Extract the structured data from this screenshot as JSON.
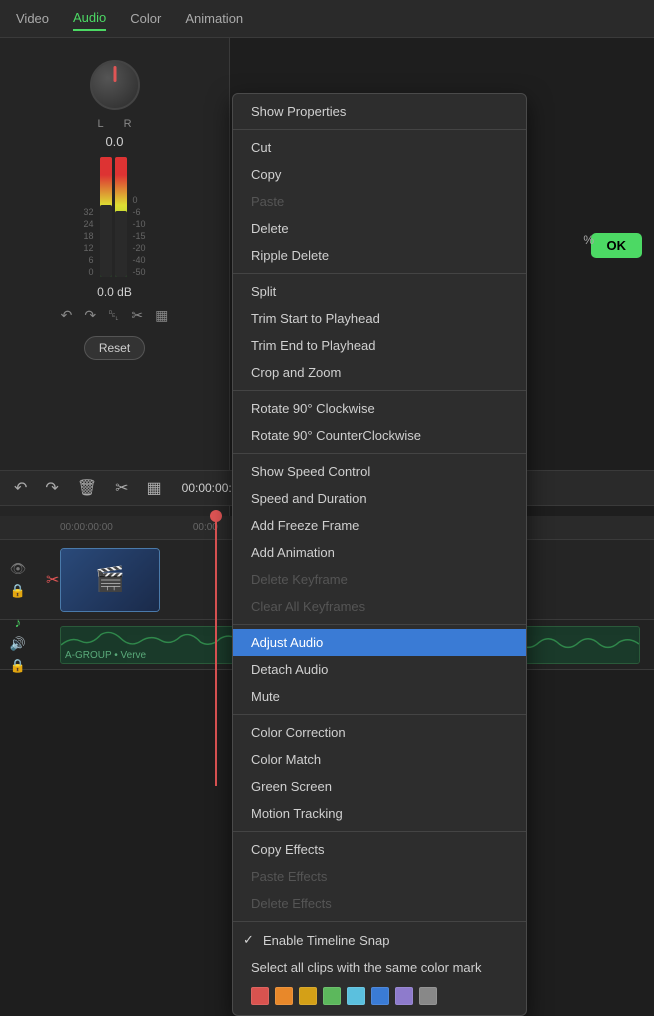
{
  "nav": {
    "items": [
      "Video",
      "Audio",
      "Color",
      "Animation"
    ],
    "active": "Audio"
  },
  "audio": {
    "volume_value": "0.0",
    "db_value": "0.0",
    "db_label": "dB",
    "reset_label": "Reset",
    "ok_label": "OK",
    "percent_label": "%"
  },
  "timeline": {
    "timecode": "00:00:00:00",
    "timecode2": "00:00",
    "track_label": "A-GROUP • Verve"
  },
  "context_menu": {
    "items": [
      {
        "id": "show-properties",
        "label": "Show Properties",
        "disabled": false,
        "highlighted": false,
        "separator_after": false
      },
      {
        "id": "cut",
        "label": "Cut",
        "disabled": false,
        "highlighted": false,
        "separator_after": false
      },
      {
        "id": "copy",
        "label": "Copy",
        "disabled": false,
        "highlighted": false,
        "separator_after": false
      },
      {
        "id": "paste",
        "label": "Paste",
        "disabled": true,
        "highlighted": false,
        "separator_after": false
      },
      {
        "id": "delete",
        "label": "Delete",
        "disabled": false,
        "highlighted": false,
        "separator_after": false
      },
      {
        "id": "ripple-delete",
        "label": "Ripple Delete",
        "disabled": false,
        "highlighted": false,
        "separator_after": true
      },
      {
        "id": "split",
        "label": "Split",
        "disabled": false,
        "highlighted": false,
        "separator_after": false
      },
      {
        "id": "trim-start",
        "label": "Trim Start to Playhead",
        "disabled": false,
        "highlighted": false,
        "separator_after": false
      },
      {
        "id": "trim-end",
        "label": "Trim End to Playhead",
        "disabled": false,
        "highlighted": false,
        "separator_after": false
      },
      {
        "id": "crop-zoom",
        "label": "Crop and Zoom",
        "disabled": false,
        "highlighted": false,
        "separator_after": true
      },
      {
        "id": "rotate-cw",
        "label": "Rotate 90° Clockwise",
        "disabled": false,
        "highlighted": false,
        "separator_after": false
      },
      {
        "id": "rotate-ccw",
        "label": "Rotate 90° CounterClockwise",
        "disabled": false,
        "highlighted": false,
        "separator_after": true
      },
      {
        "id": "speed-control",
        "label": "Show Speed Control",
        "disabled": false,
        "highlighted": false,
        "separator_after": false
      },
      {
        "id": "speed-duration",
        "label": "Speed and Duration",
        "disabled": false,
        "highlighted": false,
        "separator_after": false
      },
      {
        "id": "freeze-frame",
        "label": "Add Freeze Frame",
        "disabled": false,
        "highlighted": false,
        "separator_after": false
      },
      {
        "id": "add-animation",
        "label": "Add Animation",
        "disabled": false,
        "highlighted": false,
        "separator_after": false
      },
      {
        "id": "delete-keyframe",
        "label": "Delete Keyframe",
        "disabled": true,
        "highlighted": false,
        "separator_after": false
      },
      {
        "id": "clear-keyframes",
        "label": "Clear All Keyframes",
        "disabled": true,
        "highlighted": false,
        "separator_after": true
      },
      {
        "id": "adjust-audio",
        "label": "Adjust Audio",
        "disabled": false,
        "highlighted": true,
        "separator_after": false
      },
      {
        "id": "detach-audio",
        "label": "Detach Audio",
        "disabled": false,
        "highlighted": false,
        "separator_after": false
      },
      {
        "id": "mute",
        "label": "Mute",
        "disabled": false,
        "highlighted": false,
        "separator_after": true
      },
      {
        "id": "color-correction",
        "label": "Color Correction",
        "disabled": false,
        "highlighted": false,
        "separator_after": false
      },
      {
        "id": "color-match",
        "label": "Color Match",
        "disabled": false,
        "highlighted": false,
        "separator_after": false
      },
      {
        "id": "green-screen",
        "label": "Green Screen",
        "disabled": false,
        "highlighted": false,
        "separator_after": false
      },
      {
        "id": "motion-tracking",
        "label": "Motion Tracking",
        "disabled": false,
        "highlighted": false,
        "separator_after": true
      },
      {
        "id": "copy-effects",
        "label": "Copy Effects",
        "disabled": false,
        "highlighted": false,
        "separator_after": false
      },
      {
        "id": "paste-effects",
        "label": "Paste Effects",
        "disabled": true,
        "highlighted": false,
        "separator_after": false
      },
      {
        "id": "delete-effects",
        "label": "Delete Effects",
        "disabled": true,
        "highlighted": false,
        "separator_after": true
      },
      {
        "id": "enable-snap",
        "label": "Enable Timeline Snap",
        "disabled": false,
        "highlighted": false,
        "has_check": true,
        "separator_after": false
      },
      {
        "id": "select-same-color",
        "label": "Select all clips with the same color mark",
        "disabled": false,
        "highlighted": false,
        "separator_after": false
      }
    ],
    "color_swatches": [
      "#d9534f",
      "#e8882a",
      "#d4a017",
      "#5cb85c",
      "#5bc0de",
      "#3a7bd5",
      "#8e7bcc",
      "#888888"
    ]
  },
  "meter_labels": [
    "32",
    "24",
    "18",
    "12",
    "6",
    "0"
  ],
  "meter_labels_right": [
    "0",
    "6",
    "10",
    "15",
    "20",
    "40",
    "50"
  ]
}
